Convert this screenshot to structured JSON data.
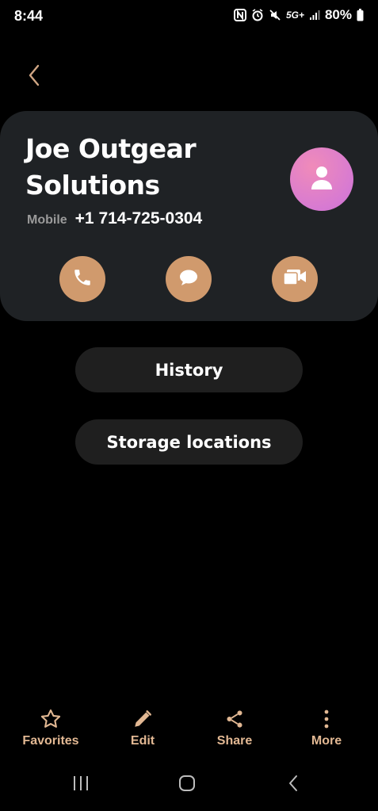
{
  "status_bar": {
    "time": "8:44",
    "network": "5G+",
    "battery": "80%"
  },
  "contact": {
    "name": "Joe Outgear Solutions",
    "phone_type": "Mobile",
    "phone_number": "+1 714-725-0304"
  },
  "actions": {
    "call_icon": "phone-icon",
    "message_icon": "chat-bubble-icon",
    "video_icon": "video-camera-icon"
  },
  "buttons": {
    "history": "History",
    "storage_locations": "Storage locations"
  },
  "toolbar": {
    "favorites": "Favorites",
    "edit": "Edit",
    "share": "Share",
    "more": "More"
  },
  "colors": {
    "background": "#000000",
    "card": "#1f2225",
    "accent": "#d09a6d",
    "toolbar_label": "#e2b893",
    "avatar": "#e086c4"
  }
}
